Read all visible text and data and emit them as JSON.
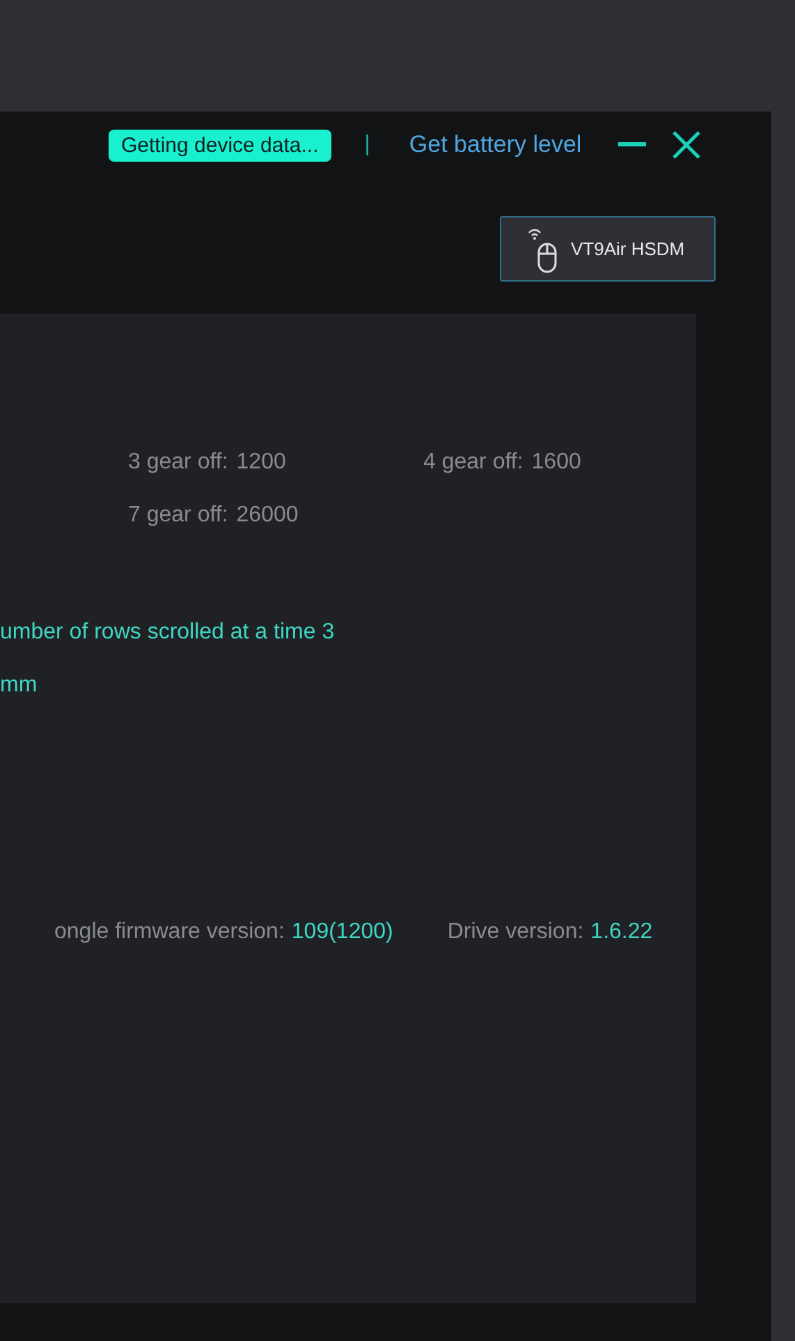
{
  "header": {
    "status_badge": "Getting device data...",
    "separator": "|",
    "battery_link": "Get battery level"
  },
  "device_button": {
    "label": "VT9Air HSDM"
  },
  "gear_settings": [
    {
      "label": "3 gear off:",
      "value": "1200"
    },
    {
      "label": "4 gear off:",
      "value": "1600"
    },
    {
      "label": "7 gear off:",
      "value": "26000"
    }
  ],
  "scroll_setting": {
    "text": "umber of rows scrolled at a time 3"
  },
  "distance_setting": {
    "text": "mm"
  },
  "versions": [
    {
      "label": "ongle firmware version:",
      "value": "109(1200)"
    },
    {
      "label": "Drive version:",
      "value": "1.6.22"
    }
  ]
}
